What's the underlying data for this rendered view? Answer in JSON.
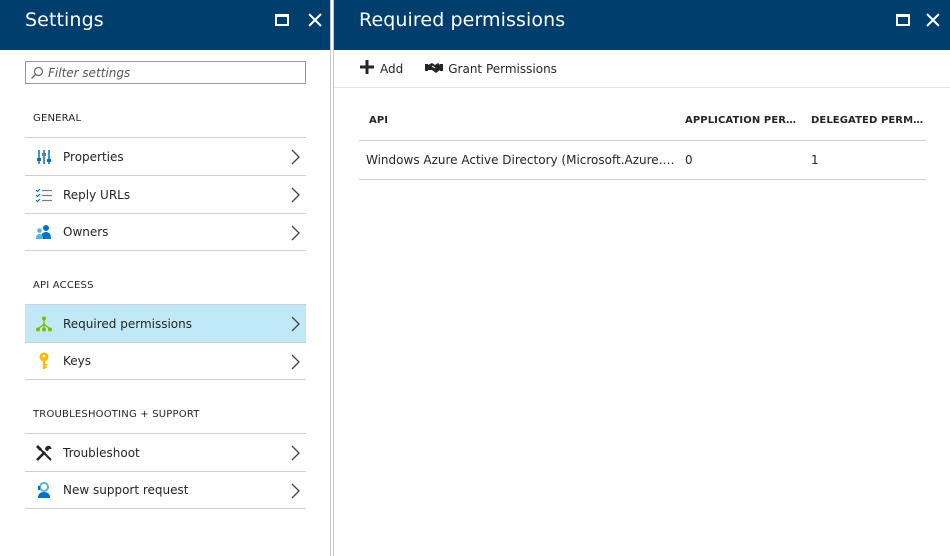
{
  "settings_blade": {
    "title": "Settings",
    "filter_placeholder": "Filter settings",
    "sections": [
      {
        "label": "GENERAL",
        "items": [
          {
            "label": "Properties",
            "icon": "sliders-icon"
          },
          {
            "label": "Reply URLs",
            "icon": "list-check-icon"
          },
          {
            "label": "Owners",
            "icon": "people-icon"
          }
        ]
      },
      {
        "label": "API ACCESS",
        "items": [
          {
            "label": "Required permissions",
            "icon": "network-tree-icon",
            "selected": true
          },
          {
            "label": "Keys",
            "icon": "key-icon"
          }
        ]
      },
      {
        "label": "TROUBLESHOOTING + SUPPORT",
        "items": [
          {
            "label": "Troubleshoot",
            "icon": "tools-icon"
          },
          {
            "label": "New support request",
            "icon": "support-person-icon"
          }
        ]
      }
    ]
  },
  "permissions_blade": {
    "title": "Required permissions",
    "toolbar": {
      "add_label": "Add",
      "grant_label": "Grant Permissions"
    },
    "table": {
      "columns": [
        "API",
        "APPLICATION PERMI...",
        "DELEGATED PERMIS..."
      ],
      "rows": [
        [
          "Windows Azure Active Directory (Microsoft.Azure.Act...",
          "0",
          "1"
        ]
      ]
    }
  },
  "colors": {
    "header_bg": "#003e6e",
    "selected_bg": "#bfe9f6",
    "accent_green": "#7fba00",
    "accent_blue": "#0072c6",
    "key_yellow": "#ffb900"
  }
}
